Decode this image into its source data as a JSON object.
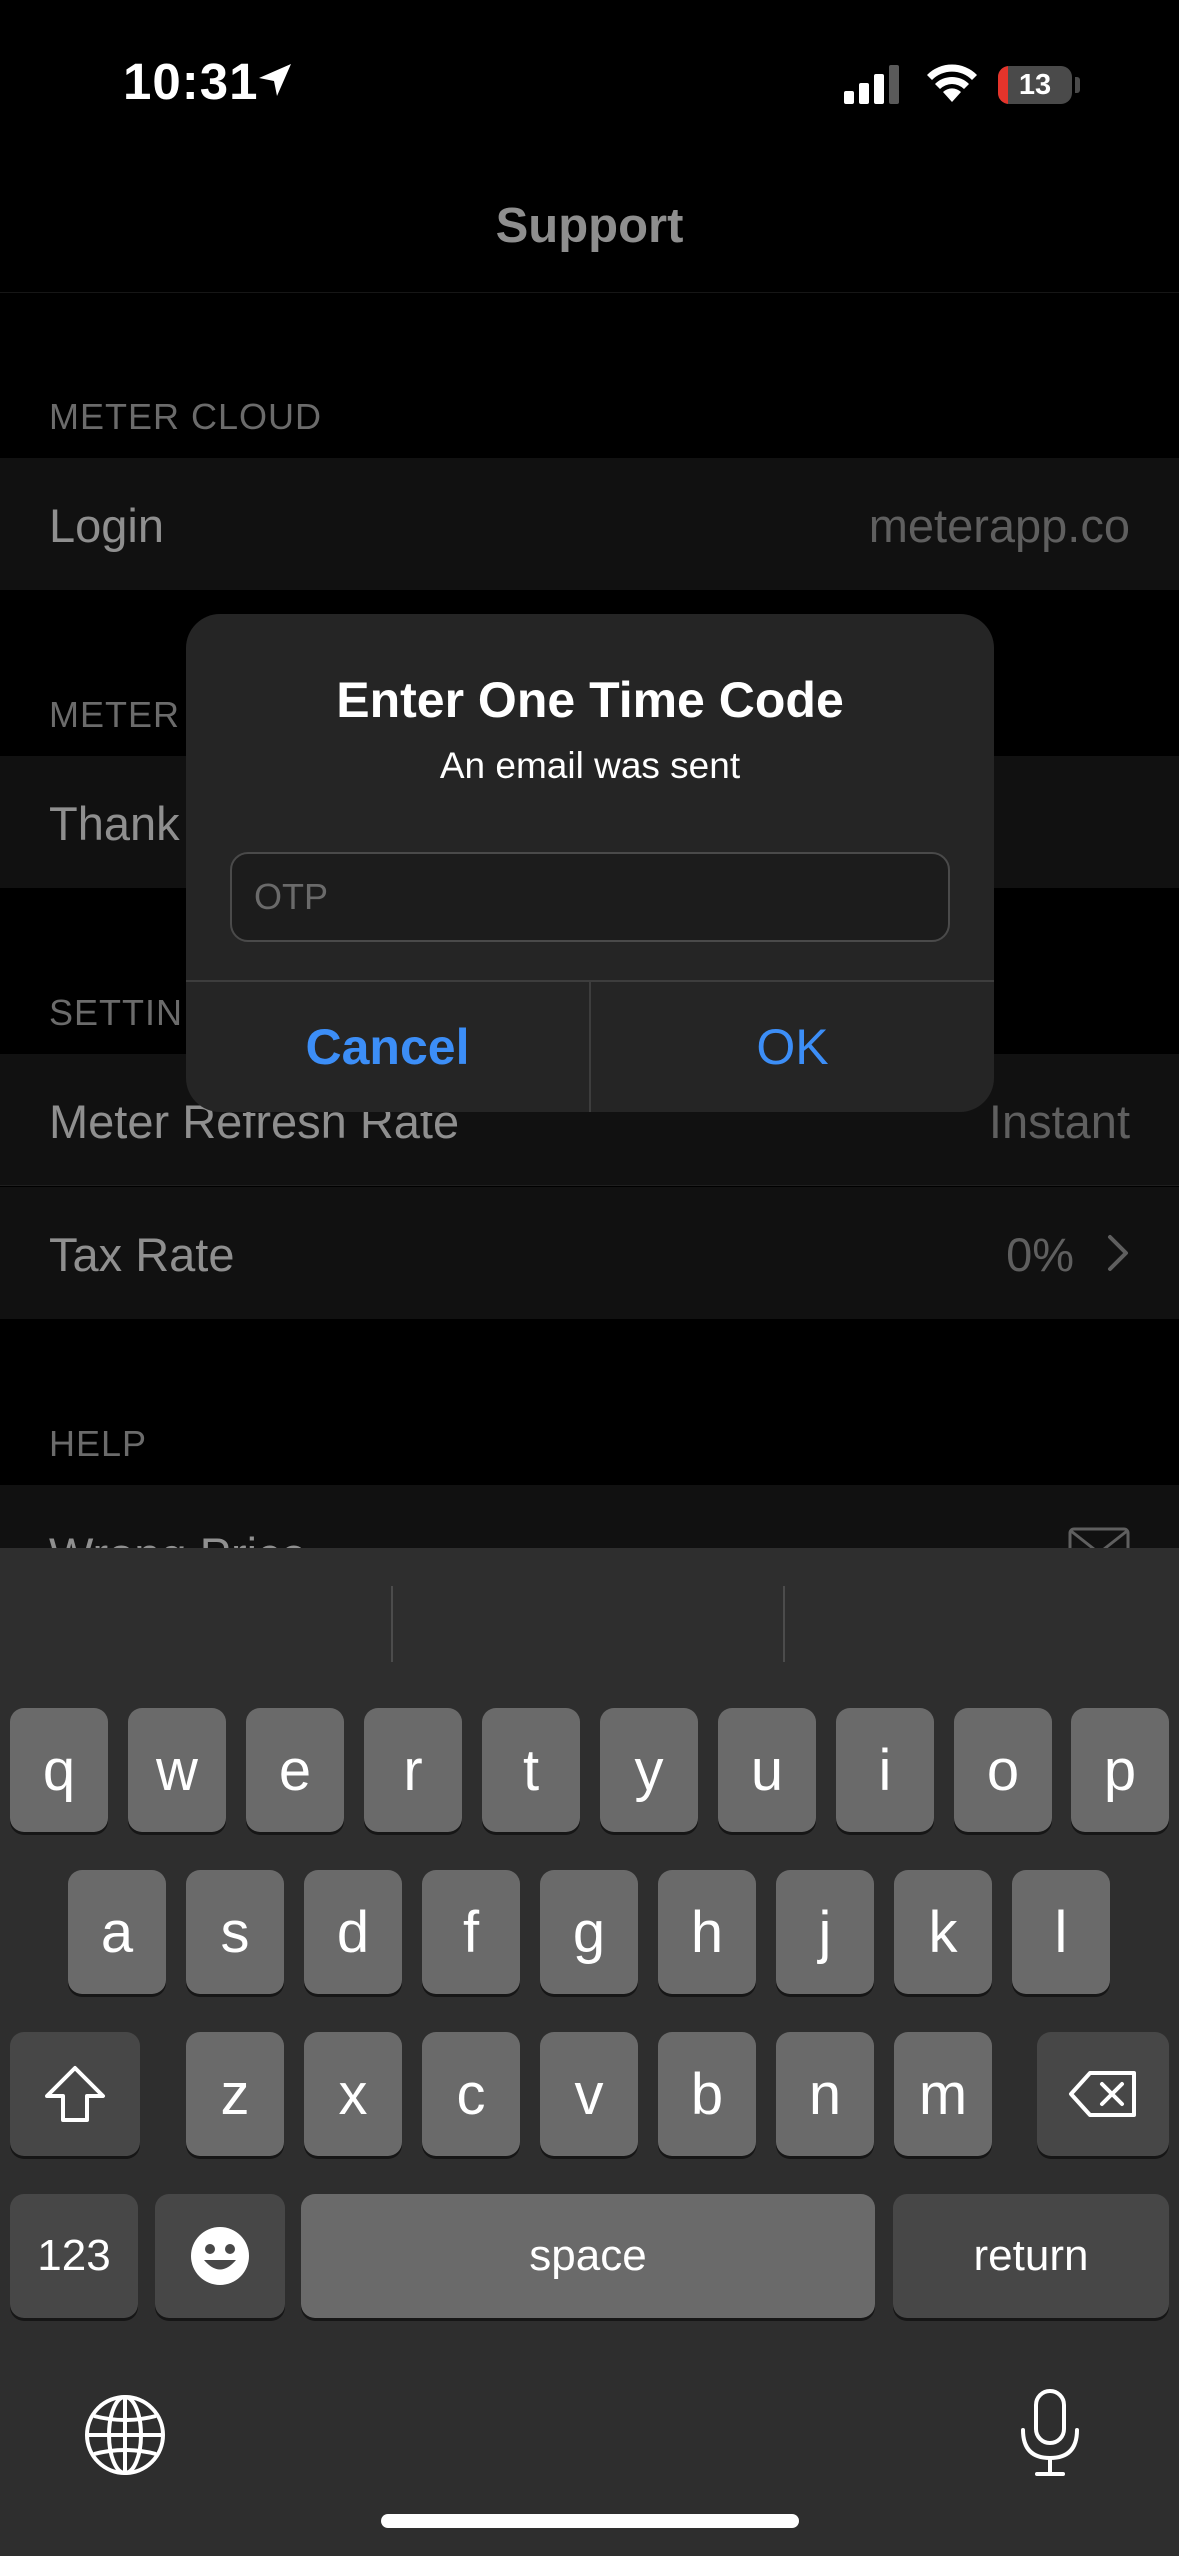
{
  "status_bar": {
    "time": "10:31",
    "battery": "13"
  },
  "nav": {
    "title": "Support"
  },
  "sections": {
    "meter_cloud": {
      "header": "METER CLOUD",
      "login_label": "Login",
      "login_value": "meterapp.co"
    },
    "meter": {
      "header": "METER",
      "thanks_label": "Thank"
    },
    "settings": {
      "header": "SETTIN",
      "refresh_label": "Meter Refresh Rate",
      "refresh_value": "Instant",
      "tax_label": "Tax Rate",
      "tax_value": "0%"
    },
    "help": {
      "header": "HELP",
      "wrong_price_label": "Wrong Price"
    }
  },
  "dialog": {
    "title": "Enter One Time Code",
    "message": "An email was sent",
    "input_placeholder": "OTP",
    "input_value": "",
    "cancel_label": "Cancel",
    "ok_label": "OK"
  },
  "keyboard": {
    "row1": [
      "q",
      "w",
      "e",
      "r",
      "t",
      "y",
      "u",
      "i",
      "o",
      "p"
    ],
    "row2": [
      "a",
      "s",
      "d",
      "f",
      "g",
      "h",
      "j",
      "k",
      "l"
    ],
    "row3": [
      "z",
      "x",
      "c",
      "v",
      "b",
      "n",
      "m"
    ],
    "numbers_label": "123",
    "space_label": "space",
    "return_label": "return"
  },
  "colors": {
    "accent": "#3c8ef7",
    "battery_low": "#e5342b"
  }
}
